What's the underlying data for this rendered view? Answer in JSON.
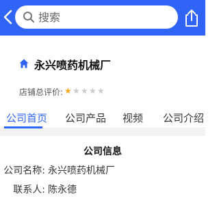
{
  "search": {
    "placeholder": "搜索"
  },
  "icons": {
    "back": "chevron-left-icon",
    "search": "search-icon",
    "share": "share-icon",
    "home": "home-icon",
    "star": "star-icon"
  },
  "colors": {
    "accent": "#2f64f6",
    "star_on": "#f5a623",
    "star_off": "#c9c9c9"
  },
  "shop": {
    "name": "永兴喷药机械厂",
    "rating_label": "店铺总评价:",
    "rating": 1,
    "rating_max": 5
  },
  "tabs": [
    {
      "label": "公司首页",
      "active": true
    },
    {
      "label": "公司产品",
      "active": false
    },
    {
      "label": "视频",
      "active": false
    },
    {
      "label": "公司介绍",
      "active": false
    }
  ],
  "company_info": {
    "title": "公司信息",
    "rows": [
      {
        "key": "公司名称:",
        "value": "永兴喷药机械厂"
      },
      {
        "key": "联系人:",
        "value": "陈永德"
      }
    ]
  }
}
